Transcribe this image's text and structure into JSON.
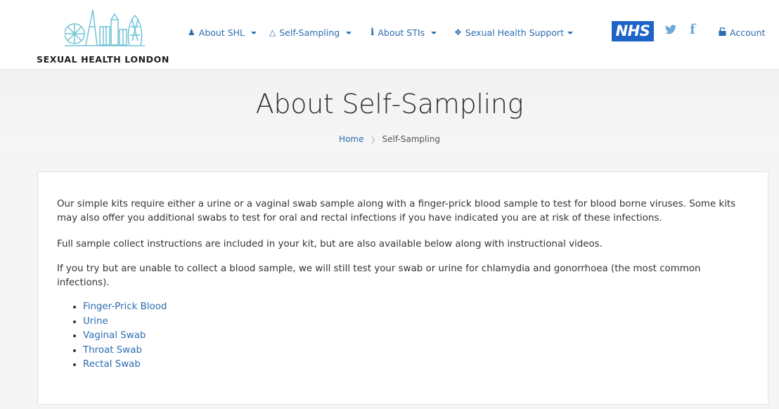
{
  "header": {
    "logo_text": "SEXUAL HEALTH LONDON",
    "nav": [
      {
        "label": "About SHL",
        "icon": "users-icon"
      },
      {
        "label": "Self-Sampling",
        "icon": "flask-icon"
      },
      {
        "label": "About STIs",
        "icon": "info-icon"
      },
      {
        "label": "Sexual Health Support",
        "icon": "ribbon-icon"
      }
    ],
    "nhs_label": "NHS",
    "twitter_icon": "twitter-icon",
    "facebook_icon": "facebook-icon",
    "account_label": "Account"
  },
  "page": {
    "title": "About Self-Sampling",
    "breadcrumb": {
      "home": "Home",
      "current": "Self-Sampling"
    }
  },
  "content": {
    "paragraphs": [
      "Our simple kits require either a urine or a vaginal swab sample along with a finger-prick blood sample to test for blood borne viruses. Some kits may also offer you additional swabs to test for oral and rectal infections if you have indicated you are at risk of these infections.",
      "Full sample collect instructions are included in your kit, but are also available below along with instructional videos.",
      "If you try but are unable to collect a blood sample, we will still test your swab or urine for chlamydia and gonorrhoea (the most common infections)."
    ],
    "links": [
      "Finger-Prick Blood",
      "Urine",
      "Vaginal Swab",
      "Throat Swab",
      "Rectal Swab"
    ]
  },
  "colors": {
    "link": "#2a6cb0",
    "nhs_blue": "#1e64c8",
    "social": "#6ca9d8"
  }
}
